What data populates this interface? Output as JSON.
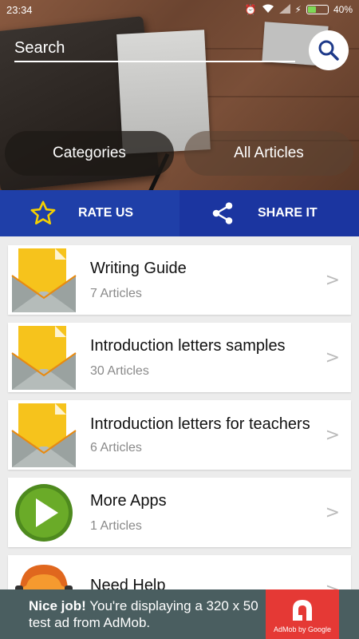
{
  "status_bar": {
    "time": "23:34",
    "battery": "40%"
  },
  "search": {
    "placeholder": "Search"
  },
  "tabs": [
    {
      "label": "Categories"
    },
    {
      "label": "All Articles"
    }
  ],
  "actions": {
    "rate": "RATE US",
    "share": "SHARE IT"
  },
  "items": [
    {
      "title": "Writing Guide",
      "sub": "7 Articles",
      "icon": "envelope-icon"
    },
    {
      "title": "Introduction letters samples",
      "sub": "30 Articles",
      "icon": "envelope-icon"
    },
    {
      "title": "Introduction letters for teachers",
      "sub": "6 Articles",
      "icon": "envelope-icon"
    },
    {
      "title": "More Apps",
      "sub": "1 Articles",
      "icon": "play-icon"
    },
    {
      "title": "Need Help",
      "sub": "",
      "icon": "support-person-icon"
    }
  ],
  "chevron": ">",
  "ad": {
    "bold": "Nice job!",
    "text": "You're displaying a 320 x 50 test ad from AdMob.",
    "caption": "AdMob by Google"
  },
  "colors": {
    "action_blue": "#1f3fa8",
    "ad_bg": "#4a5e60",
    "ad_red": "#e53935",
    "battery_green": "#7ed957"
  }
}
